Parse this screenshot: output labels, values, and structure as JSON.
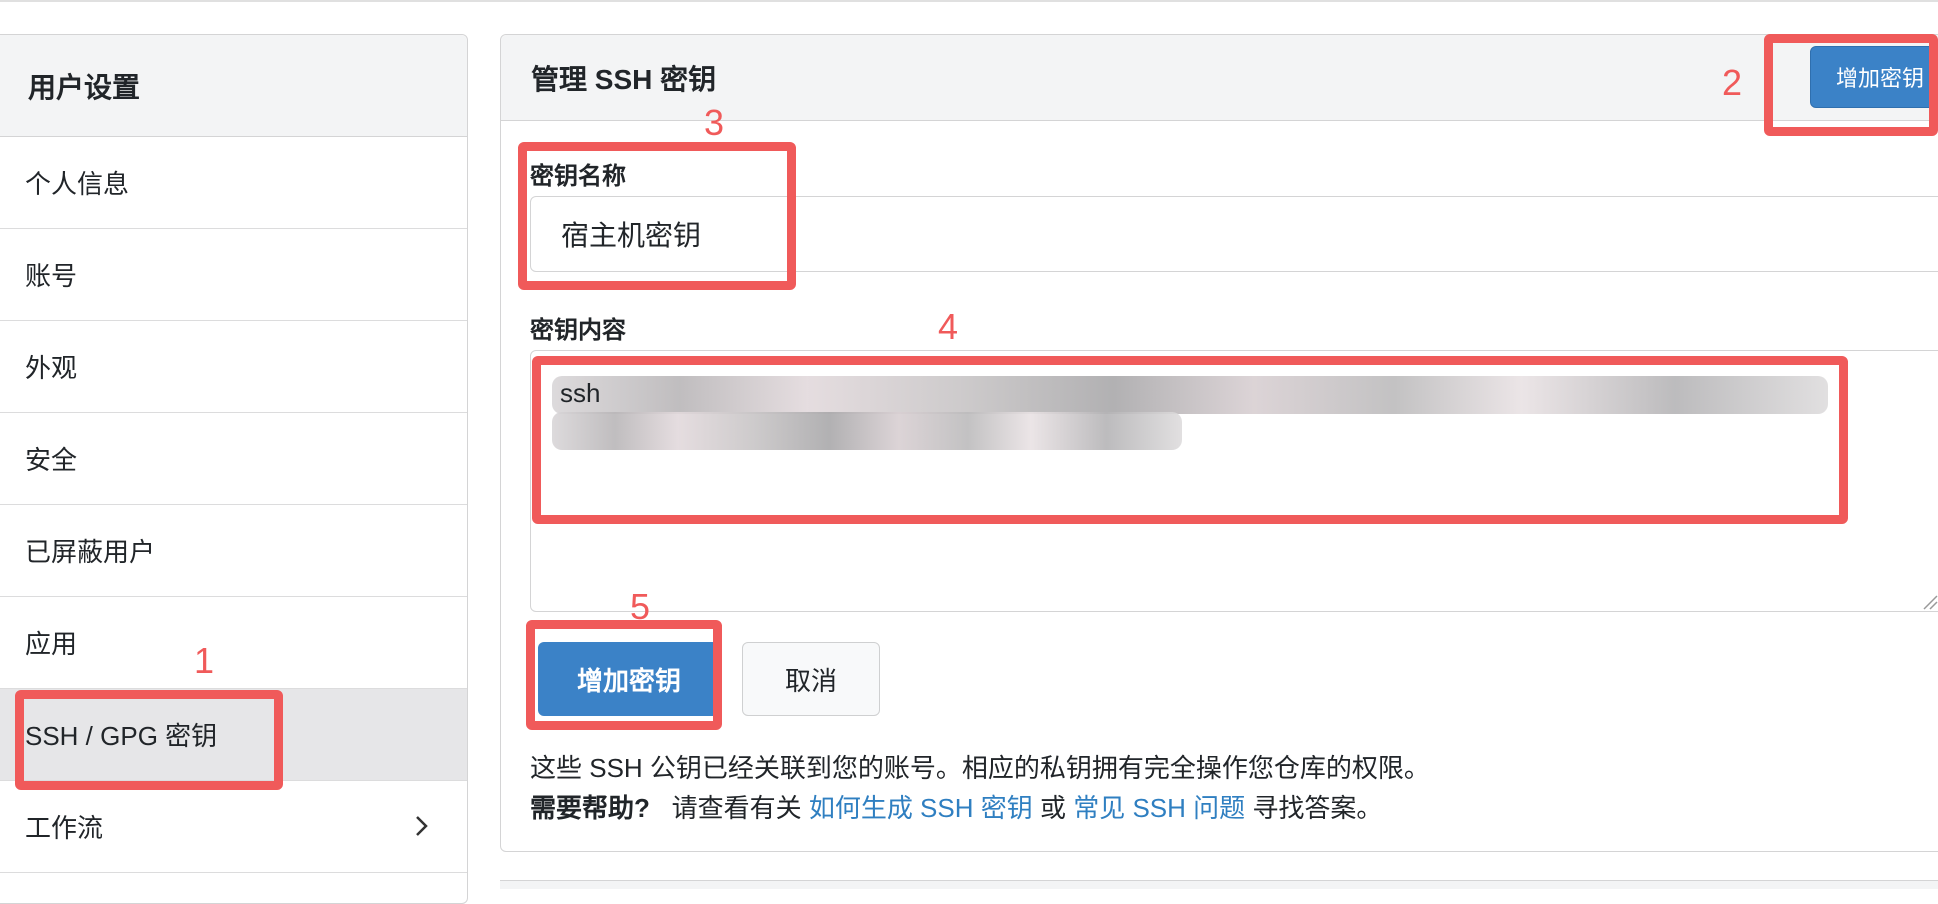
{
  "sidebar": {
    "title": "用户设置",
    "items": [
      {
        "label": "个人信息"
      },
      {
        "label": "账号"
      },
      {
        "label": "外观"
      },
      {
        "label": "安全"
      },
      {
        "label": "已屏蔽用户"
      },
      {
        "label": "应用"
      },
      {
        "label": "SSH / GPG 密钥",
        "active": true
      },
      {
        "label": "工作流"
      }
    ]
  },
  "panel": {
    "title": "管理 SSH 密钥",
    "header_add_button": "增加密钥",
    "name_label": "密钥名称",
    "name_value": "宿主机密钥",
    "content_label": "密钥内容",
    "content_prefix": "ssh",
    "submit_button": "增加密钥",
    "cancel_button": "取消",
    "info_text": "这些 SSH 公钥已经关联到您的账号。相应的私钥拥有完全操作您仓库的权限。",
    "help_bold": "需要帮助?",
    "help_lead": "请查看有关",
    "help_link1": "如何生成 SSH 密钥",
    "help_or": "或",
    "help_link2": "常见 SSH 问题",
    "help_tail": "寻找答案。"
  },
  "annotations": {
    "n1": "1",
    "n2": "2",
    "n3": "3",
    "n4": "4",
    "n5": "5",
    "color": "#f05a5a"
  },
  "colors": {
    "primary": "#3b82c7",
    "link": "#2f7fc1",
    "header_bg": "#f3f4f5"
  }
}
